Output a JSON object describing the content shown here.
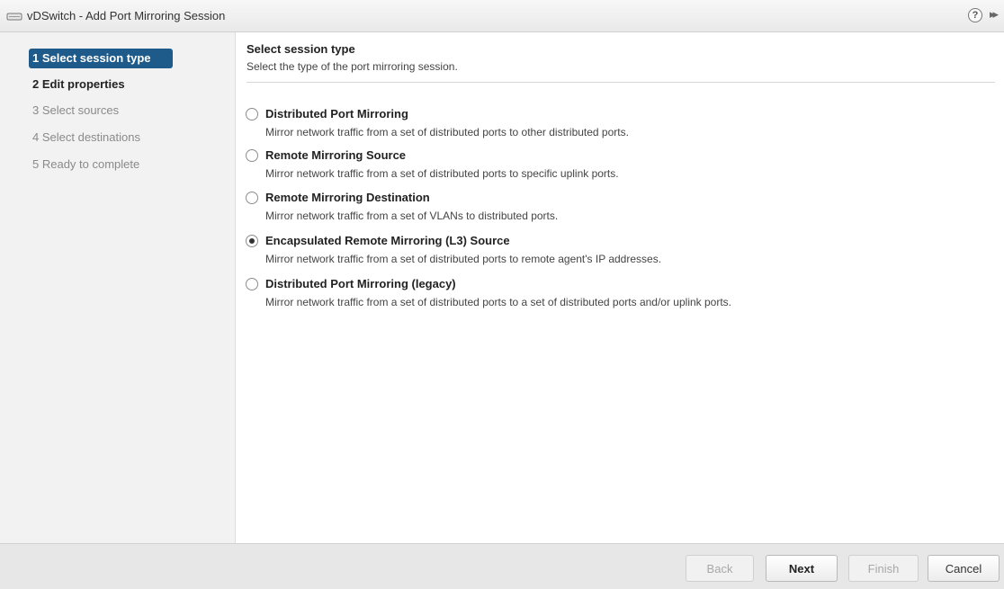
{
  "window": {
    "title": "vDSwitch - Add Port Mirroring Session",
    "help_glyph": "?",
    "expand_glyph": "▸▸"
  },
  "steps": [
    {
      "label": "1 Select session type",
      "state": "active"
    },
    {
      "label": "2 Edit properties",
      "state": "done"
    },
    {
      "label": "3 Select sources",
      "state": "disabled"
    },
    {
      "label": "4 Select destinations",
      "state": "disabled"
    },
    {
      "label": "5 Ready to complete",
      "state": "disabled"
    }
  ],
  "main": {
    "heading": "Select session type",
    "subheading": "Select the type of the port mirroring session.",
    "options": [
      {
        "label": "Distributed Port Mirroring",
        "description": "Mirror network traffic from a set of distributed ports to other distributed ports.",
        "selected": false
      },
      {
        "label": "Remote Mirroring Source",
        "description": "Mirror network traffic from a set of distributed ports to specific uplink ports.",
        "selected": false
      },
      {
        "label": "Remote Mirroring Destination",
        "description": "Mirror network traffic from a set of VLANs to distributed ports.",
        "selected": false
      },
      {
        "label": "Encapsulated Remote Mirroring (L3) Source",
        "description": "Mirror network traffic from a set of distributed ports to remote agent's IP addresses.",
        "selected": true
      },
      {
        "label": "Distributed Port Mirroring (legacy)",
        "description": "Mirror network traffic from a set of distributed ports to a set of distributed ports and/or uplink ports.",
        "selected": false
      }
    ]
  },
  "footer": {
    "back_label": "Back",
    "next_label": "Next",
    "finish_label": "Finish",
    "cancel_label": "Cancel"
  },
  "colors": {
    "active_step_bg": "#1f5b8a",
    "sidebar_bg": "#f2f2f2",
    "footer_bg": "#e7e7e7"
  }
}
